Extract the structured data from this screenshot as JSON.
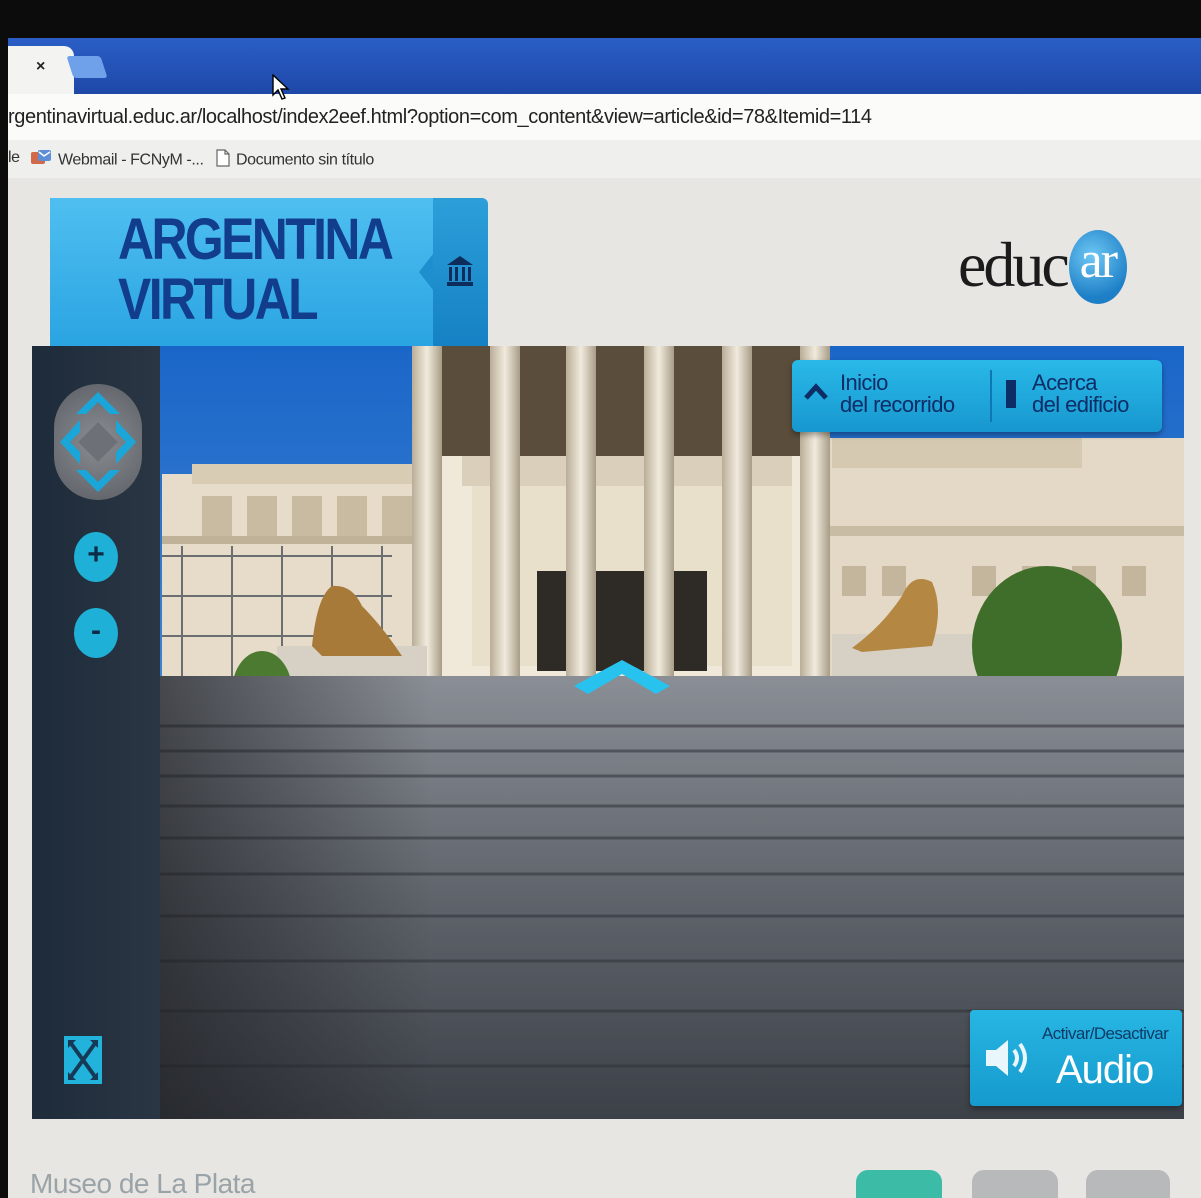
{
  "browser": {
    "tab_close": "×",
    "url": "rgentinavirtual.educ.ar/localhost/index2eef.html?option=com_content&view=article&id=78&Itemid=114",
    "bookmarks": [
      {
        "label": "le",
        "icon": "bookmark-fragment"
      },
      {
        "label": "Webmail - FCNyM -...",
        "icon": "mail-icon"
      },
      {
        "label": "Documento sin título",
        "icon": "document-icon"
      }
    ]
  },
  "header": {
    "title_line1": "ARGENTINA",
    "title_line2": "VIRTUAL",
    "home_icon": "museum-icon",
    "logo_text": "educ",
    "logo_badge": "ar"
  },
  "viewer": {
    "zoom_in": "+",
    "zoom_out": "-",
    "nav_buttons": [
      {
        "line1": "Inicio",
        "line2": "del recorrido",
        "icon": "chevron-up-icon"
      },
      {
        "line1": "Acerca",
        "line2": "del edificio",
        "icon": "info-bar-icon"
      }
    ],
    "audio": {
      "small": "Activar/Desactivar",
      "big": "Audio",
      "icon": "speaker-icon"
    }
  },
  "footer": {
    "title": "Museo de La Plata"
  },
  "colors": {
    "accent": "#2aa4e2",
    "title_text": "#123c8c",
    "browser_blue": "#1e48a8"
  }
}
